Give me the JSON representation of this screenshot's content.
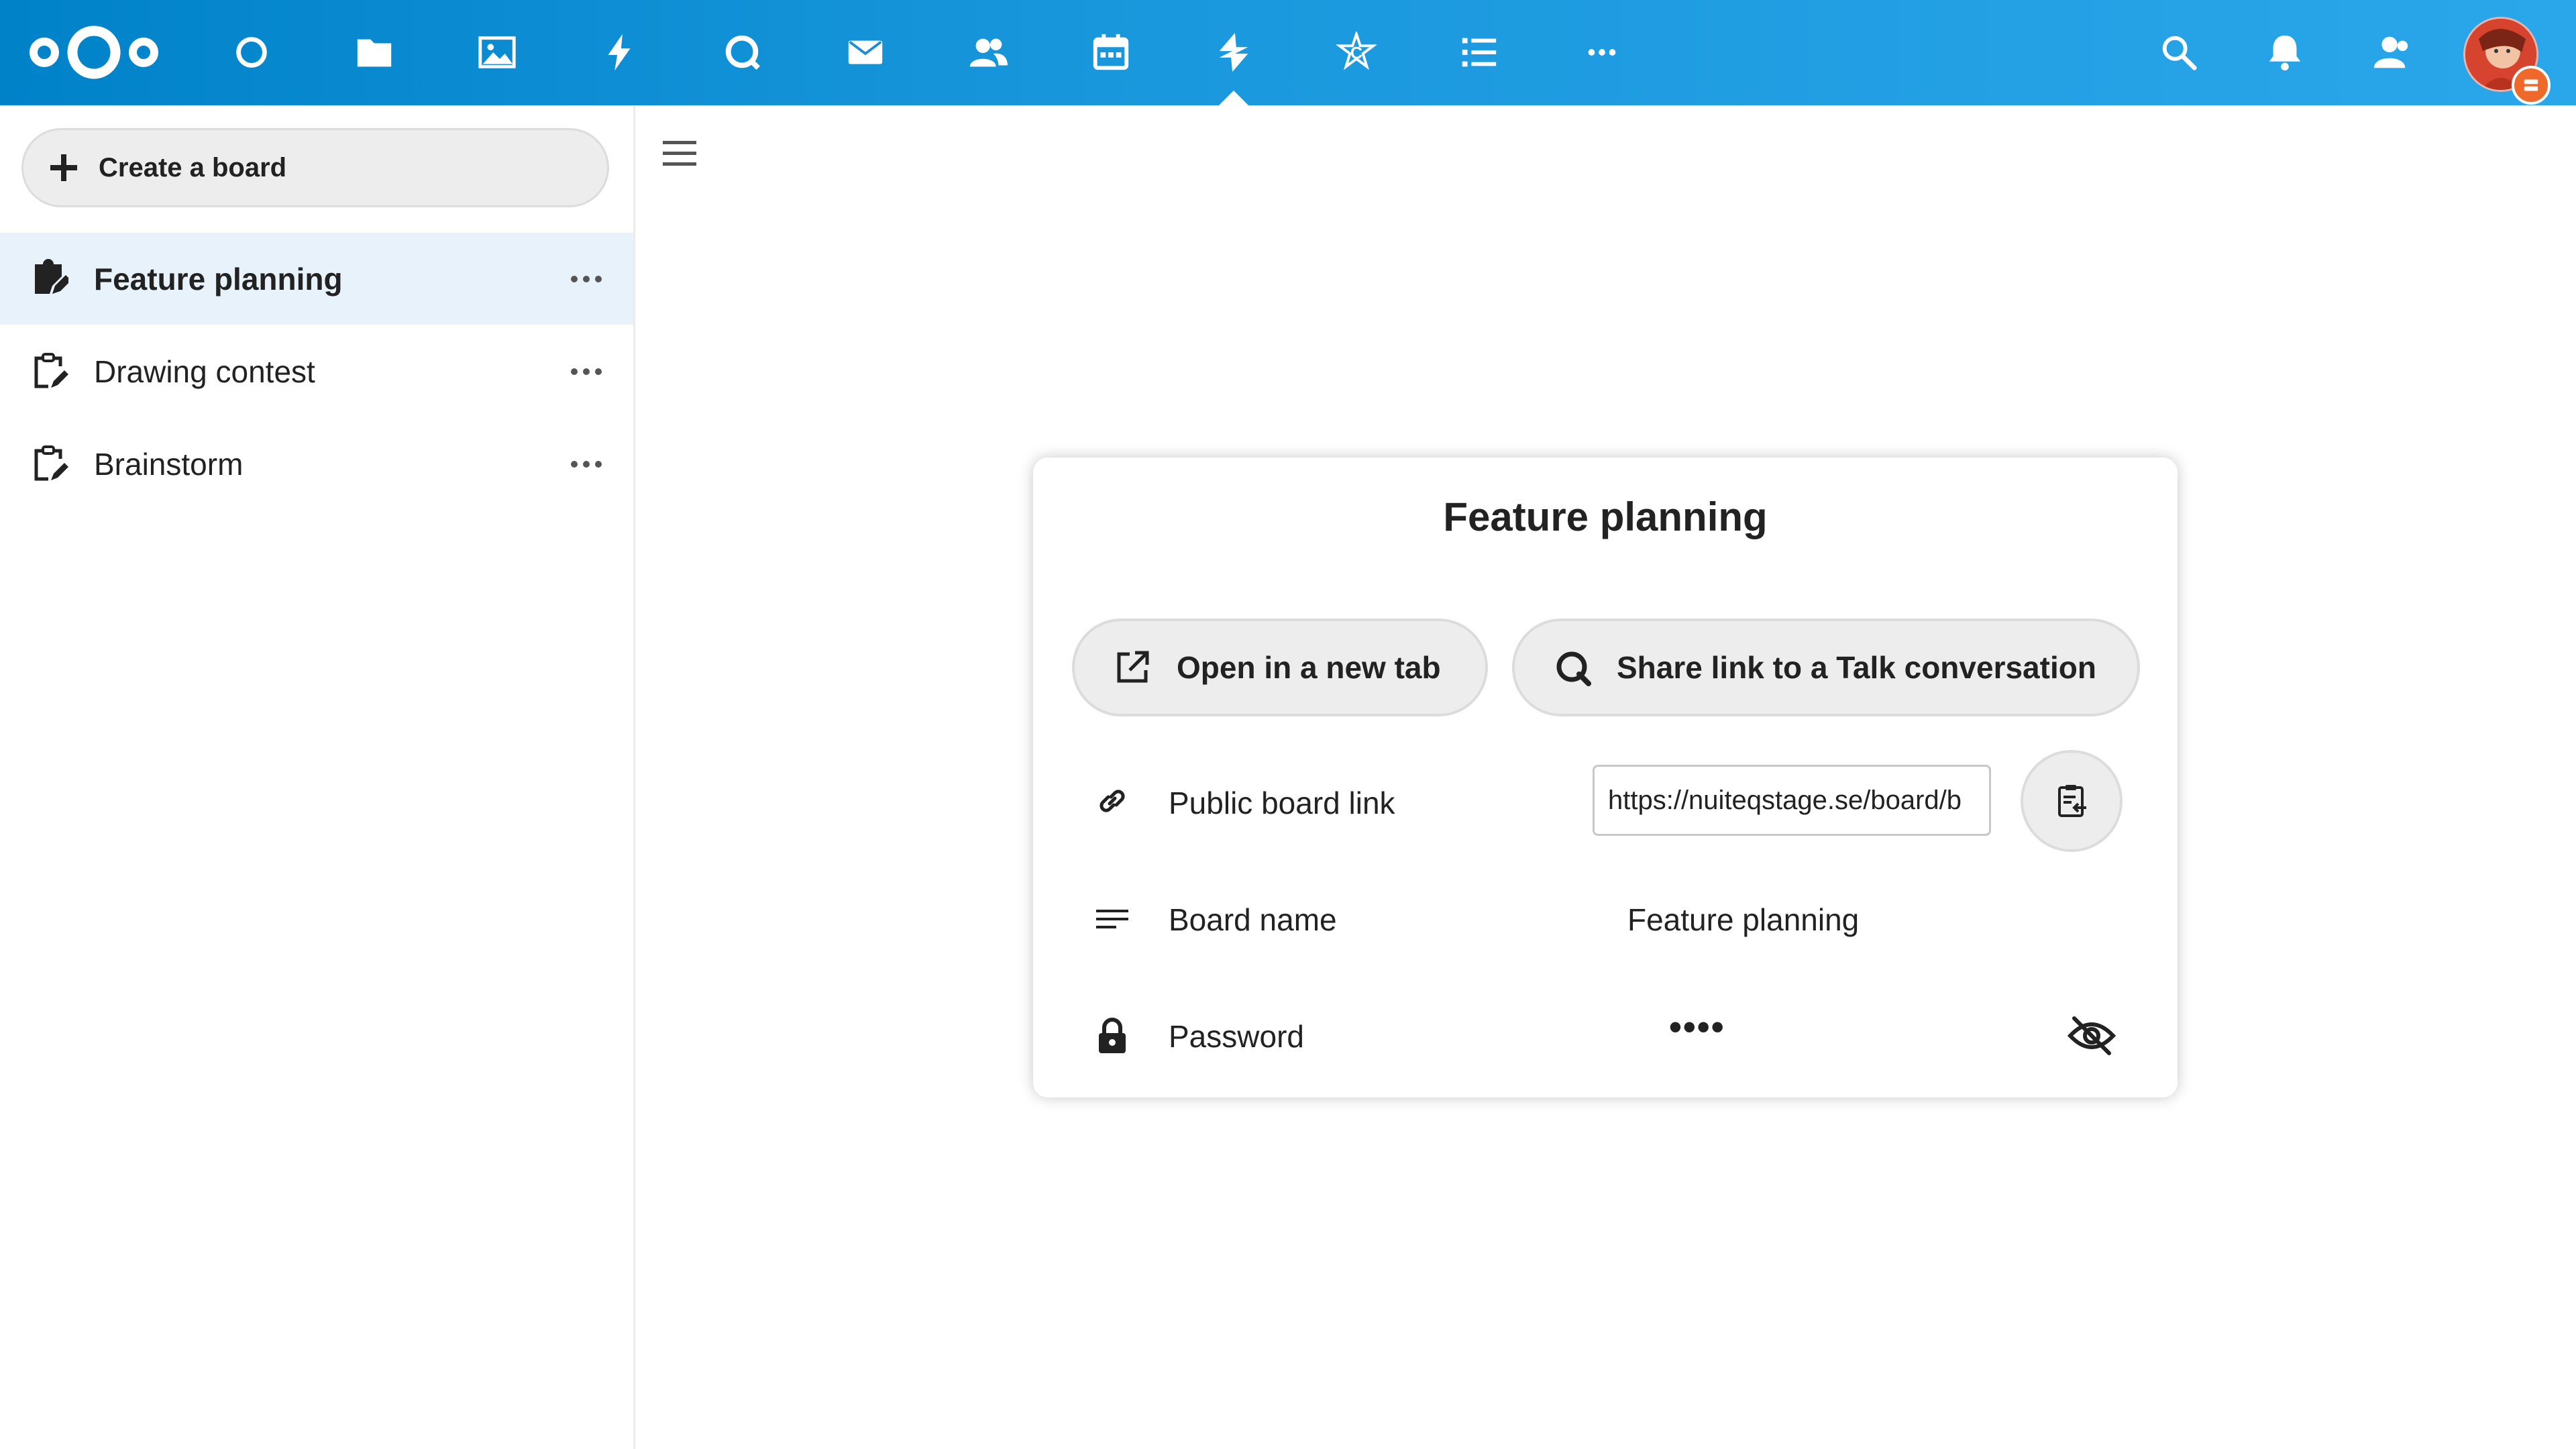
{
  "topbar": {
    "logo_name": "nextcloud-logo",
    "apps": [
      {
        "name": "dashboard-icon"
      },
      {
        "name": "files-icon"
      },
      {
        "name": "photos-icon"
      },
      {
        "name": "activity-icon"
      },
      {
        "name": "talk-icon"
      },
      {
        "name": "mail-icon"
      },
      {
        "name": "contacts-icon"
      },
      {
        "name": "calendar-icon"
      },
      {
        "name": "deck-icon",
        "active": true
      },
      {
        "name": "circles-icon"
      },
      {
        "name": "tasks-icon"
      },
      {
        "name": "more-apps-icon"
      }
    ],
    "right_icons": [
      "search-icon",
      "notifications-icon",
      "contacts-menu-icon",
      "user-avatar"
    ],
    "accent_color": "#0082c9"
  },
  "sidebar": {
    "create_label": "Create a board",
    "boards": [
      {
        "label": "Feature planning",
        "active": true
      },
      {
        "label": "Drawing contest",
        "active": false
      },
      {
        "label": "Brainstorm",
        "active": false
      }
    ]
  },
  "modal": {
    "title": "Feature planning",
    "open_new_tab_label": "Open in a new tab",
    "share_talk_label": "Share link to a Talk conversation",
    "public_link_label": "Public board link",
    "public_link_value": "https://nuiteqstage.se/board/b",
    "board_name_label": "Board name",
    "board_name_value": "Feature planning",
    "password_label": "Password",
    "password_value": "••••"
  }
}
